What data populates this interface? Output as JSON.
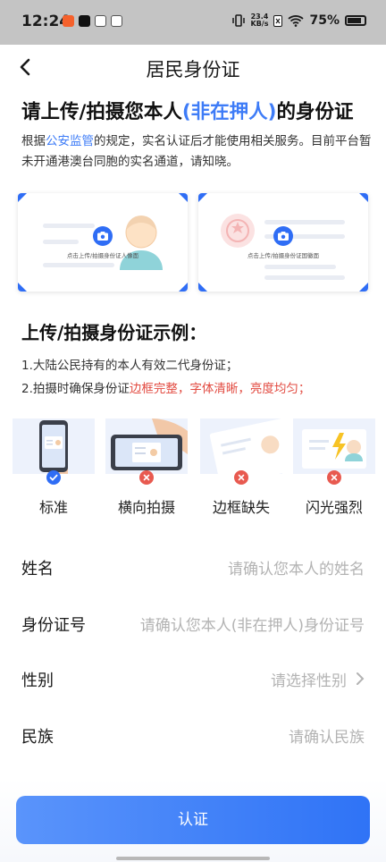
{
  "status_bar": {
    "time": "12:24",
    "net_speed_value": "23.4",
    "net_speed_unit": "KB/s",
    "battery": "75%"
  },
  "nav": {
    "title": "居民身份证"
  },
  "headline": {
    "prefix": "请上传/拍摄您本人",
    "highlight": "(非在押人)",
    "suffix": "的身份证"
  },
  "notice": {
    "part1": "根据",
    "link": "公安监管",
    "part2": "的规定，实名认证后才能使用相关服务。目前平台暂未开通港澳台同胞的实名通道，请知晓。"
  },
  "cards": [
    {
      "label": "点击上传/拍摄身份证人像面"
    },
    {
      "label": "点击上传/拍摄身份证国徽面"
    }
  ],
  "examples_section": {
    "title": "上传/拍摄身份证示例：",
    "rule1": "1.大陆公民持有的本人有效二代身份证；",
    "rule2_prefix": "2.拍摄时确保身份证",
    "rule2_highlight": "边框完整，字体清晰，亮度均匀；"
  },
  "examples": [
    {
      "label": "标准",
      "status": "ok"
    },
    {
      "label": "横向拍摄",
      "status": "bad"
    },
    {
      "label": "边框缺失",
      "status": "bad"
    },
    {
      "label": "闪光强烈",
      "status": "bad"
    }
  ],
  "form": {
    "name_label": "姓名",
    "name_placeholder": "请确认您本人的姓名",
    "id_label": "身份证号",
    "id_placeholder": "请确认您本人(非在押人)身份证号",
    "gender_label": "性别",
    "gender_placeholder": "请选择性别",
    "ethnicity_label": "民族",
    "ethnicity_placeholder": "请确认民族"
  },
  "submit": {
    "label": "认证"
  },
  "colors": {
    "accent": "#3e7cf7",
    "warning": "#e24a40"
  }
}
